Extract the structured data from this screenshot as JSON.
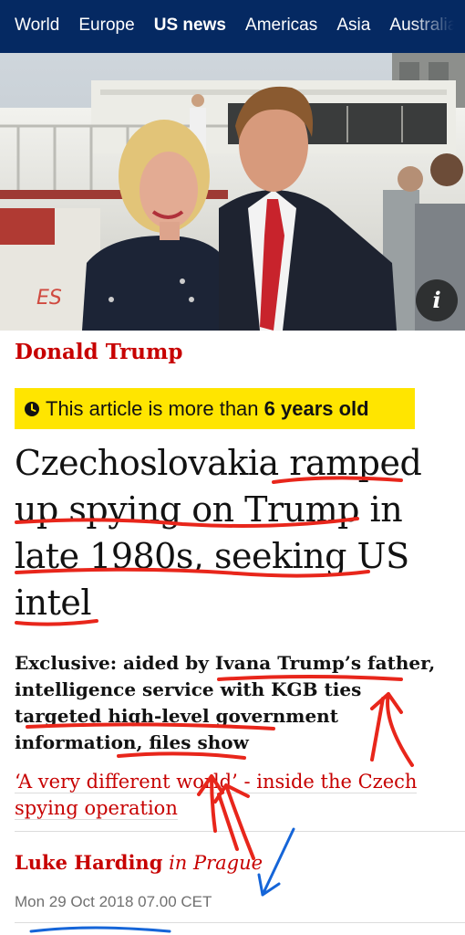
{
  "nav": {
    "items": [
      "World",
      "Europe",
      "US news",
      "Americas",
      "Asia",
      "Australia"
    ],
    "active_index": 2
  },
  "hero": {
    "info_label": "i",
    "boat_lettering": "ES"
  },
  "article": {
    "kicker": "Donald Trump",
    "age_notice": {
      "prefix": "This article is more than ",
      "emphasis": "6 years old"
    },
    "headline": "Czechoslovakia ramped up spying on Trump in late 1980s, seeking US intel",
    "standfirst": "Exclusive: aided by Ivana Trump’s father, intelligence service with KGB ties targeted high-level government information, files show",
    "related_link": "‘A very different world’ - inside the Czech spying operation",
    "byline": {
      "name": "Luke Harding",
      "location": "in Prague"
    },
    "date": "Mon 29 Oct 2018 07.00 CET"
  },
  "colors": {
    "nav_background": "#052962",
    "accent_red": "#c70000",
    "banner_yellow": "#ffe500",
    "annotation_red": "#e8261b",
    "annotation_blue": "#1565d8"
  }
}
